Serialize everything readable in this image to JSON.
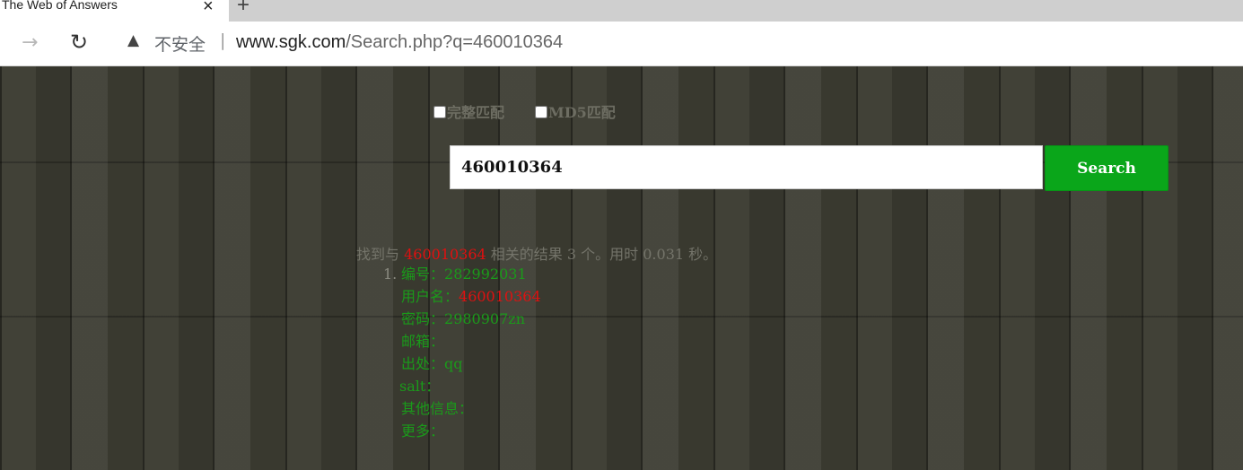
{
  "browser": {
    "tab_title": "The Web of Answers",
    "tab_close": "×",
    "new_tab": "+",
    "forward_icon": "→",
    "reload_icon": "↻",
    "warning_icon": "▲",
    "insecure_label": "不安全",
    "separator": "|",
    "url_host": "www.sgk.com",
    "url_path": "/Search.php?q=460010364"
  },
  "search": {
    "full_match_label": "完整匹配",
    "md5_match_label": "MD5匹配",
    "query": "460010364",
    "button_label": "Search"
  },
  "summary": {
    "prefix": "找到与 ",
    "term": "460010364",
    "suffix": " 相关的结果 3 个。用时 0.031 秒。"
  },
  "results": [
    {
      "index": "1.",
      "id_label": "编号：",
      "id_value": "282992031",
      "username_label": "用户名：",
      "username_value": "460010364",
      "password_label": "密码：",
      "password_value": "2980907zn",
      "email_label": "邮箱：",
      "email_value": "",
      "source_label": "出处：",
      "source_value": "qq",
      "salt_label": "salt：",
      "salt_value": "",
      "other_label": "其他信息：",
      "other_value": "",
      "more_label": "更多：",
      "more_value": ""
    }
  ],
  "colors": {
    "accent_green": "#0aa61a",
    "result_green": "#1a9a1a",
    "highlight_red": "#e01010"
  }
}
